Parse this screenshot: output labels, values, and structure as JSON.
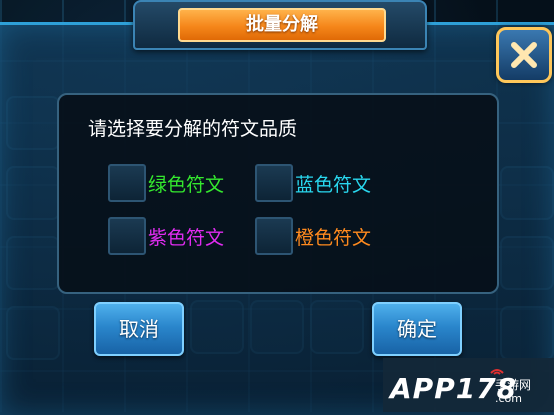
{
  "dialog": {
    "title": "批量分解",
    "prompt": "请选择要分解的符文品质",
    "options": [
      {
        "label": "绿色符文",
        "color": "#34e82e",
        "checked": false
      },
      {
        "label": "蓝色符文",
        "color": "#29d7ee",
        "checked": false
      },
      {
        "label": "紫色符文",
        "color": "#e02cf0",
        "checked": false
      },
      {
        "label": "橙色符文",
        "color": "#ff8a1e",
        "checked": false
      }
    ],
    "cancel_label": "取消",
    "confirm_label": "确定",
    "close_icon": "close-icon"
  },
  "watermark": {
    "main": "APP178",
    "sub": "手游网",
    "domain": ".com"
  },
  "colors": {
    "title_bg": "#f5861a",
    "button_bg": "#2a86cc",
    "close_border": "#ffc75a"
  }
}
